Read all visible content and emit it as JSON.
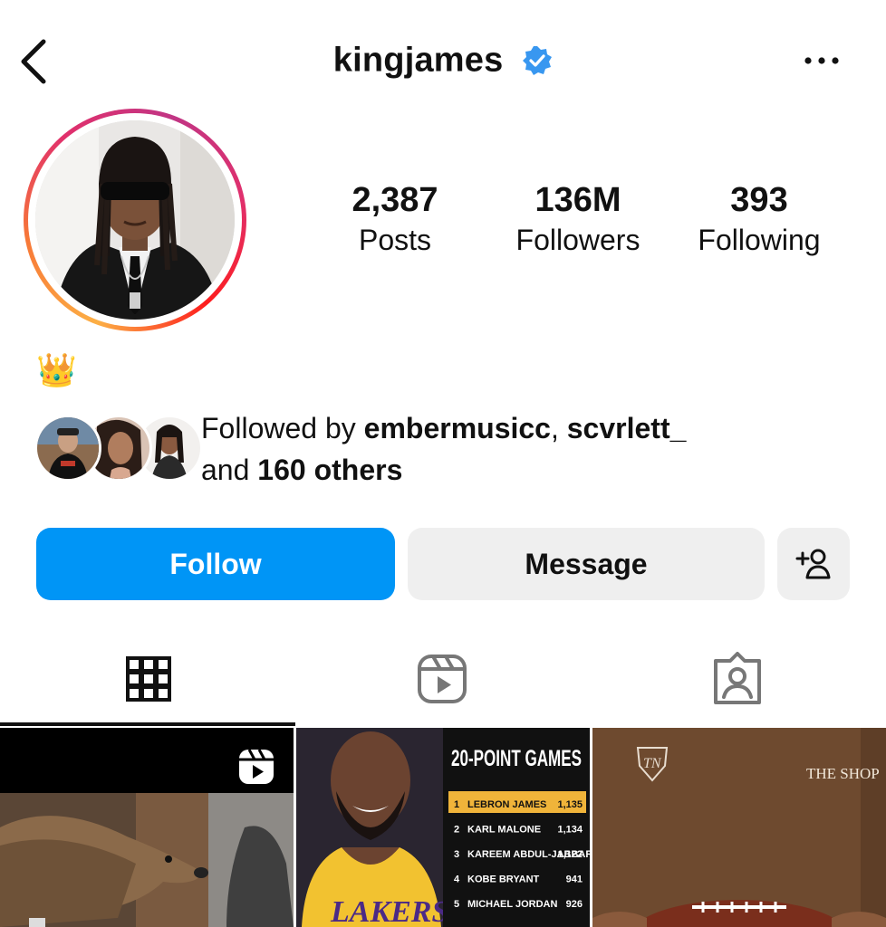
{
  "header": {
    "username": "kingjames",
    "back_icon": "chevron-left-icon",
    "verified_icon": "verified-badge-icon",
    "more_icon": "more-horizontal-icon"
  },
  "stats": {
    "posts_value": "2,387",
    "posts_label": "Posts",
    "followers_value": "136M",
    "followers_label": "Followers",
    "following_value": "393",
    "following_label": "Following"
  },
  "bio": {
    "text": "👑"
  },
  "followed_by": {
    "prefix": "Followed by ",
    "user1": "embermusicc",
    "separator": ", ",
    "user2": "scvrlett_",
    "and_text": "and ",
    "others": "160 others"
  },
  "actions": {
    "follow_label": "Follow",
    "message_label": "Message",
    "add_user_icon": "add-person-icon"
  },
  "tabs": [
    {
      "name": "posts-grid",
      "icon": "grid-icon",
      "active": true
    },
    {
      "name": "reels",
      "icon": "reels-icon",
      "active": false
    },
    {
      "name": "tagged",
      "icon": "tagged-person-icon",
      "active": false
    }
  ],
  "posts": {
    "post2_title": "20-POINT GAMES",
    "post2_rows": [
      {
        "rank": "1",
        "name": "LEBRON JAMES",
        "value": "1,135"
      },
      {
        "rank": "2",
        "name": "KARL MALONE",
        "value": "1,134"
      },
      {
        "rank": "3",
        "name": "KAREEM ABDUL-JABBAR",
        "value": "1,122"
      },
      {
        "rank": "4",
        "name": "KOBE BRYANT",
        "value": "941"
      },
      {
        "rank": "5",
        "name": "MICHAEL JORDAN",
        "value": "926"
      }
    ],
    "post2_jersey_text": "LAKERS",
    "post3_title": "THE SHOP"
  },
  "colors": {
    "follow_blue": "#0095f6",
    "verified_blue": "#3897f0",
    "button_gray": "#efefef"
  }
}
